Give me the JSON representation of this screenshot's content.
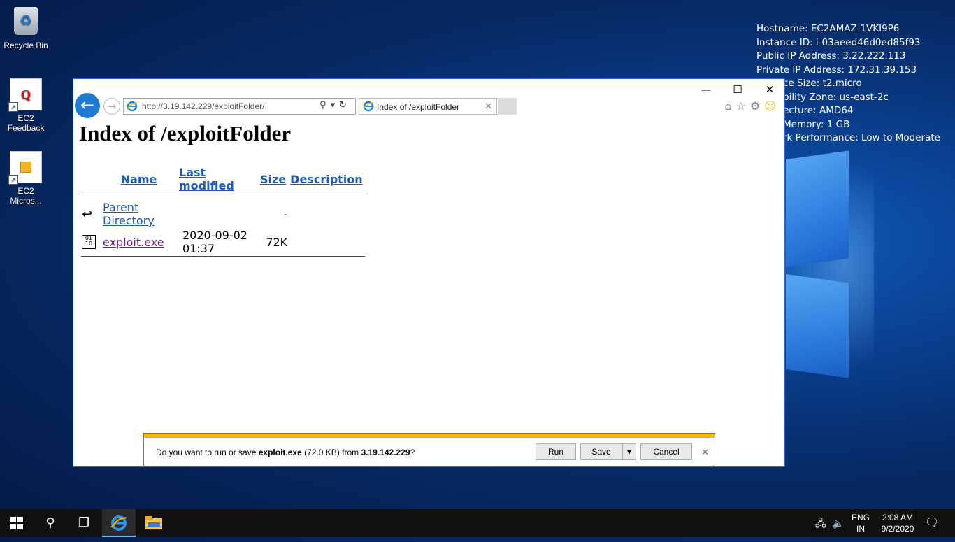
{
  "desktop": {
    "icons": [
      {
        "label": "Recycle Bin"
      },
      {
        "label": "EC2 Feedback"
      },
      {
        "label": "EC2 Micros..."
      }
    ],
    "sysinfo": [
      "Hostname: EC2AMAZ-1VKI9P6",
      "Instance ID: i-03aeed46d0ed85f93",
      "Public IP Address: 3.22.222.113",
      "Private IP Address: 172.31.39.153",
      "ce Size: t2.micro",
      "bility Zone: us-east-2c",
      "ecture: AMD64",
      "Memory: 1 GB",
      "rk Performance: Low to Moderate"
    ]
  },
  "browser": {
    "address": "http://3.19.142.229/exploitFolder/",
    "tab_label": "Index of /exploitFolder",
    "page": {
      "heading": "Index of /exploitFolder",
      "columns": [
        "Name",
        "Last modified",
        "Size",
        "Description"
      ],
      "rows": [
        {
          "name": "Parent Directory",
          "modified": "",
          "size": "-",
          "desc": ""
        },
        {
          "name": "exploit.exe",
          "modified": "2020-09-02 01:37",
          "size": "72K",
          "desc": ""
        }
      ]
    },
    "download_bar": {
      "prefix": "Do you want to run or save ",
      "filename": "exploit.exe",
      "size_text": " (72.0 KB) from ",
      "host": "3.19.142.229",
      "suffix": "?",
      "run": "Run",
      "save": "Save",
      "cancel": "Cancel"
    }
  },
  "taskbar": {
    "lang_top": "ENG",
    "lang_bottom": "IN",
    "time": "2:08 AM",
    "date": "9/2/2020"
  }
}
